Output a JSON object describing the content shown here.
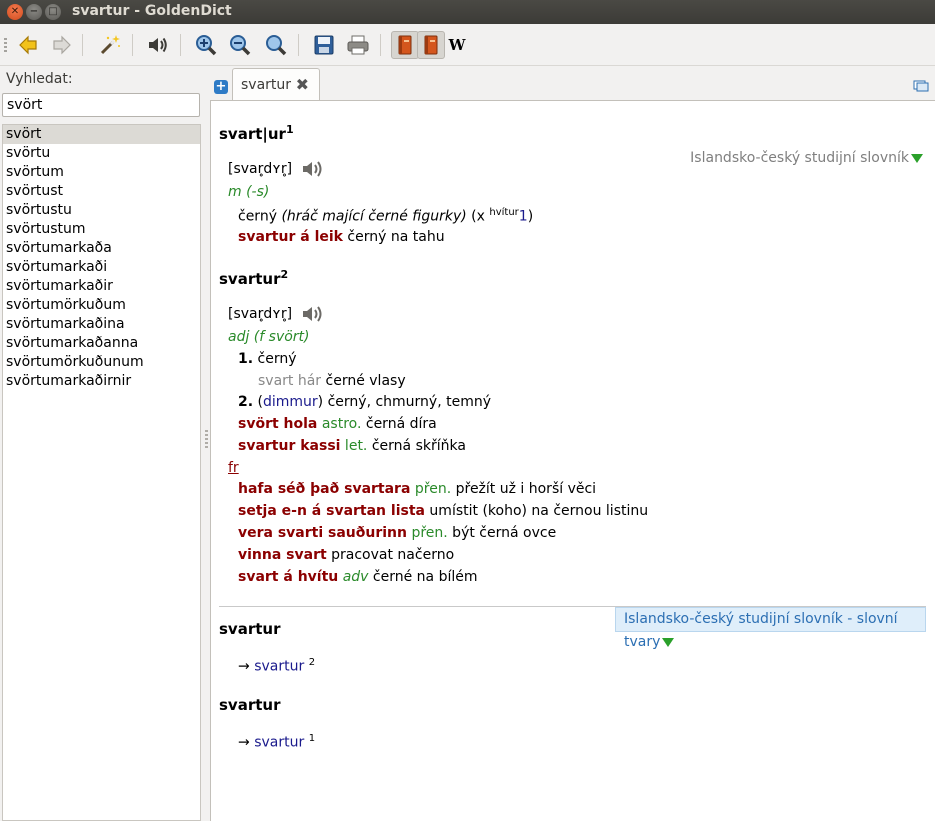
{
  "window": {
    "title": "svartur - GoldenDict"
  },
  "toolbar": {
    "wikipedia_label": "W"
  },
  "left": {
    "search_label": "Vyhledat:",
    "search_value": "svört",
    "words": [
      "svört",
      "svörtu",
      "svörtum",
      "svörtust",
      "svörtustu",
      "svörtustum",
      "svörtumarkaða",
      "svörtumarkaði",
      "svörtumarkaðir",
      "svörtumörkuðum",
      "svörtumarkaðina",
      "svörtumarkaðanna",
      "svörtumörkuðunum",
      "svörtumarkaðirnir"
    ]
  },
  "tab": {
    "label": "svartur"
  },
  "article": {
    "dict1_name": "Islandsko-český studijní slovník",
    "e1": {
      "hw": "svart|ur",
      "hw_sup": "1",
      "pron": "[svar̥dʏr̥]",
      "pos": "m (-s)",
      "def_a": "černý ",
      "def_b": "(hráč mající černé figurky)",
      "def_c": " (x ",
      "def_sup": "hvítur",
      "def_link": "1",
      "def_end": ")",
      "phrase": "svartur á leik",
      "phrase_tr": " černý na tahu"
    },
    "e2": {
      "hw": "svartur",
      "hw_sup": "2",
      "pron": "[svar̥dʏr̥]",
      "pos": "adj (f svört)",
      "s1_num": "1.",
      "s1_text": " černý",
      "s1_ex": "svart hár",
      "s1_ex_tr": " černé vlasy",
      "s2_num": "2.",
      "s2_open": " (",
      "s2_dim": "dimmur",
      "s2_text": ") černý, chmurný, temný",
      "p1": "svört hola",
      "p1_lab": " astro.",
      "p1_tr": " černá díra",
      "p2": "svartur kassi",
      "p2_lab": " let.",
      "p2_tr": " černá skříňka",
      "fr": "fr",
      "i1": "hafa séð það svartara",
      "i1_lab": " přen.",
      "i1_tr": " přežít už i horší věci",
      "i2": "setja e-n á svartan lista",
      "i2_tr": " umístit (koho) na černou listinu",
      "i3": "vera svarti sauðurinn",
      "i3_lab": " přen.",
      "i3_tr": " být černá ovce",
      "i4": "vinna svart",
      "i4_tr": " pracovat načerno",
      "i5": "svart á hvítu",
      "i5_lab": " adv",
      "i5_tr": " černé na bílém"
    },
    "dict2_name": "Islandsko-český studijní slovník - slovní tvary",
    "f1": {
      "hw": "svartur",
      "arrow": "→ ",
      "link": "svartur",
      "sup": "2"
    },
    "f2": {
      "hw": "svartur",
      "arrow": "→ ",
      "link": "svartur",
      "sup": "1"
    }
  },
  "colors": {
    "accent_green": "#2aa02a",
    "phrase_red": "#8b0000",
    "link_blue": "#1a1a8c"
  }
}
